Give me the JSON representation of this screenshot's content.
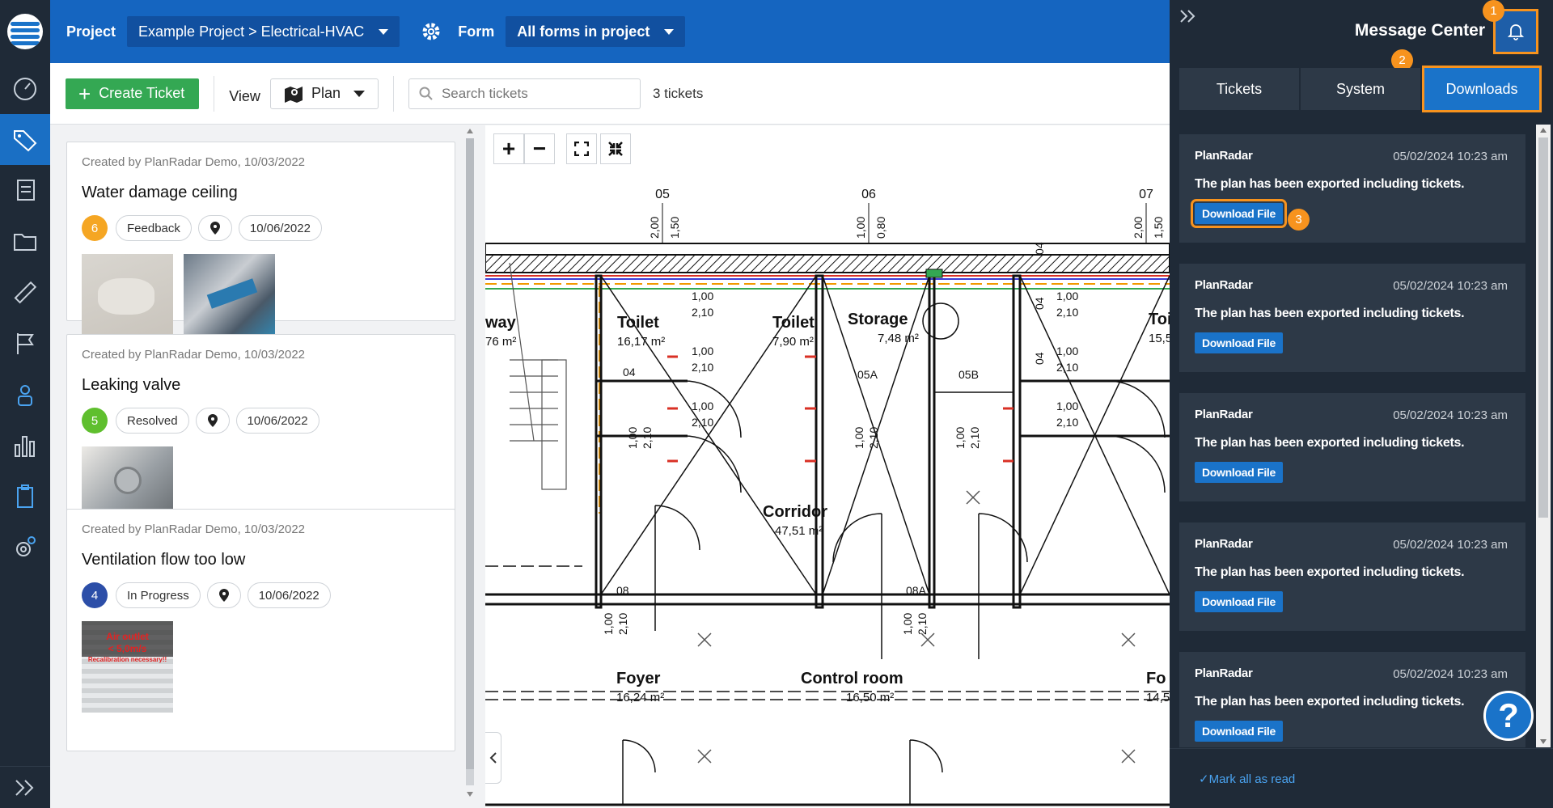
{
  "topbar": {
    "project_label": "Project",
    "project_value": "Example Project > Electrical-HVAC",
    "form_label": "Form",
    "form_value": "All forms in project"
  },
  "toolbar": {
    "create_label": "Create Ticket",
    "view_label": "View",
    "view_value": "Plan",
    "search_placeholder": "Search tickets",
    "ticket_count": "3 tickets"
  },
  "tickets": [
    {
      "meta": "Created by PlanRadar Demo, 10/03/2022",
      "title": "Water damage ceiling",
      "number": "6",
      "number_color": "#f5a623",
      "status": "Feedback",
      "date": "10/06/2022"
    },
    {
      "meta": "Created by PlanRadar Demo, 10/03/2022",
      "title": "Leaking valve",
      "number": "5",
      "number_color": "#5fbf2e",
      "status": "Resolved",
      "date": "10/06/2022"
    },
    {
      "meta": "Created by PlanRadar Demo, 10/03/2022",
      "title": "Ventilation flow too low",
      "number": "4",
      "number_color": "#2c4ea8",
      "status": "In Progress",
      "date": "10/06/2022",
      "photo_text_1": "Air outlet",
      "photo_text_2": "< 5,0m/s",
      "photo_text_3": "Recalibration necessary!!"
    }
  ],
  "plan": {
    "axis_05": "05",
    "axis_06": "06",
    "axis_07": "07",
    "rooms": [
      {
        "name": "Toilet",
        "area": "16,17 m²"
      },
      {
        "name": "Toilet",
        "area": "7,90 m²"
      },
      {
        "name": "Storage",
        "area": "7,48 m²"
      },
      {
        "name": "Corridor",
        "area": "47,51 m²"
      },
      {
        "name": "Foyer",
        "area": "16,24 m²"
      },
      {
        "name": "Control room",
        "area": "16,50 m²"
      },
      {
        "name": "way",
        "area": "76 m²"
      },
      {
        "name": "Toi",
        "area": "15,5"
      },
      {
        "name": "Fo",
        "area": "14,5"
      }
    ],
    "dims": {
      "d1": "1,00",
      "d2": "2,10",
      "d3": "1,00",
      "d4": "2,10",
      "d5": "1,00",
      "d6": "2,10",
      "d7": "1,00",
      "d8": "2,10",
      "d9": "1,00",
      "d10": "2,10",
      "d11": "1,00",
      "d12": "2,10",
      "v1": "2,00",
      "v2": "1,50",
      "v3": "1,00",
      "v4": "0,80",
      "v5": "2,00",
      "v6": "1,50",
      "v7": "1,00",
      "v8": "2,10",
      "v9": "1,00",
      "v10": "2,10",
      "v11": "1,00",
      "v12": "2,10",
      "v13": "1,00",
      "v14": "2,10",
      "v15": "1,00",
      "v16": "2,10"
    },
    "door_labels": {
      "a": "04",
      "b": "05A",
      "c": "05B",
      "d": "04",
      "e": "04",
      "f": "04",
      "g": "08",
      "h": "08A"
    }
  },
  "message_center": {
    "title": "Message Center",
    "tabs": [
      "Tickets",
      "System",
      "Downloads"
    ],
    "messages": [
      {
        "sender": "PlanRadar",
        "time": "05/02/2024 10:23 am",
        "text": "The plan has been exported including tickets.",
        "action": "Download File"
      },
      {
        "sender": "PlanRadar",
        "time": "05/02/2024 10:23 am",
        "text": "The plan has been exported including tickets.",
        "action": "Download File"
      },
      {
        "sender": "PlanRadar",
        "time": "05/02/2024 10:23 am",
        "text": "The plan has been exported including tickets.",
        "action": "Download File"
      },
      {
        "sender": "PlanRadar",
        "time": "05/02/2024 10:23 am",
        "text": "The plan has been exported including tickets.",
        "action": "Download File"
      },
      {
        "sender": "PlanRadar",
        "time": "05/02/2024 10:23 am",
        "text": "The plan has been exported including tickets.",
        "action": "Download File"
      }
    ],
    "mark_all_read": "✓Mark all as read",
    "callouts": [
      "1",
      "2",
      "3"
    ]
  },
  "help_label": "?",
  "colors": {
    "brand_blue": "#1565c0",
    "accent_orange": "#f7931e",
    "create_green": "#34a853",
    "panel_dark": "#1f2a37"
  }
}
